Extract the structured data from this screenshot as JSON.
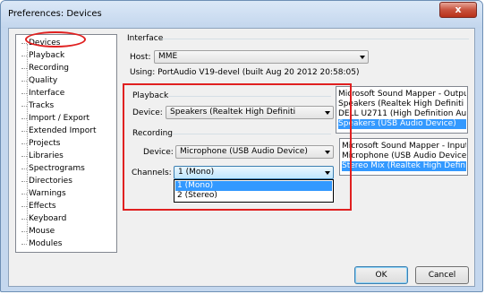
{
  "window": {
    "title": "Preferences: Devices",
    "close_glyph": "x"
  },
  "tree": {
    "items": [
      "Devices",
      "Playback",
      "Recording",
      "Quality",
      "Interface",
      "Tracks",
      "Import / Export",
      "Extended Import",
      "Projects",
      "Libraries",
      "Spectrograms",
      "Directories",
      "Warnings",
      "Effects",
      "Keyboard",
      "Mouse",
      "Modules"
    ],
    "selected": "Devices"
  },
  "interface": {
    "group_label": "Interface",
    "host_label": "Host:",
    "host_value": "MME",
    "using_text": "Using: PortAudio V19-devel (built Aug 20 2012 20:58:05)"
  },
  "playback": {
    "group_label": "Playback",
    "device_label": "Device:",
    "device_value": "Speakers (Realtek High Definiti",
    "list": [
      "Microsoft Sound Mapper - Output",
      "Speakers (Realtek High Definiti",
      "DELL U2711 (High Definition Aud",
      "Speakers (USB Audio Device)"
    ],
    "list_selected_index": 3
  },
  "recording": {
    "group_label": "Recording",
    "device_label": "Device:",
    "device_value": "Microphone (USB Audio Device)",
    "channels_label": "Channels:",
    "channels_value": "1 (Mono)",
    "channels_options": [
      "1 (Mono)",
      "2 (Stereo)"
    ],
    "channels_selected_index": 0,
    "list": [
      "Microsoft Sound Mapper - Input",
      "Microphone (USB Audio Device)",
      "Stereo Mix (Realtek High Defini"
    ],
    "list_selected_index": 2
  },
  "buttons": {
    "ok": "OK",
    "cancel": "Cancel"
  },
  "colors": {
    "highlight": "#3399ff",
    "annotation": "#e02020"
  }
}
